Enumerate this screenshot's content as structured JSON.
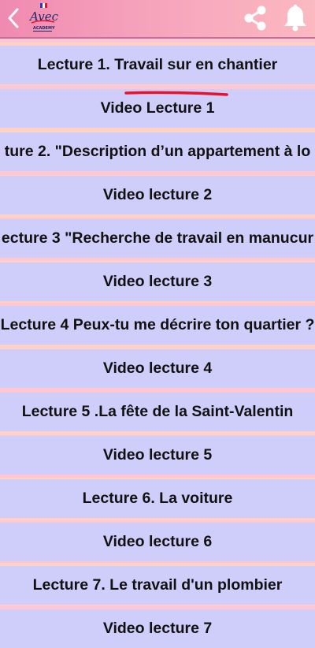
{
  "header": {
    "back_icon": "chevron-left-icon",
    "logo_text_main": "Avec",
    "logo_text_sub": "ACADEMY",
    "share_icon": "share-icon",
    "bell_icon": "bell-icon"
  },
  "items": [
    {
      "label": "Lecture 1. Travail sur en chantier"
    },
    {
      "label": "Video Lecture  1"
    },
    {
      "label": "ture 2. \"Description d’un appartement à lo"
    },
    {
      "label": "Video lecture 2"
    },
    {
      "label": "ecture 3 \"Recherche de travail en manucur"
    },
    {
      "label": "Video lecture 3"
    },
    {
      "label": "Lecture 4 Peux-tu me décrire ton quartier ?"
    },
    {
      "label": "Video lecture 4"
    },
    {
      "label": "Lecture 5 .La fête de la  Saint-Valentin"
    },
    {
      "label": "Video lecture 5"
    },
    {
      "label": "Lecture 6. La voiture"
    },
    {
      "label": "Video lecture 6"
    },
    {
      "label": "Lecture 7. Le travail d'un plombier"
    },
    {
      "label": "Video lecture 7"
    }
  ],
  "colors": {
    "row_bg": "#cfcdfa",
    "separator": "#ffc7d2",
    "underline": "#e8122c"
  }
}
